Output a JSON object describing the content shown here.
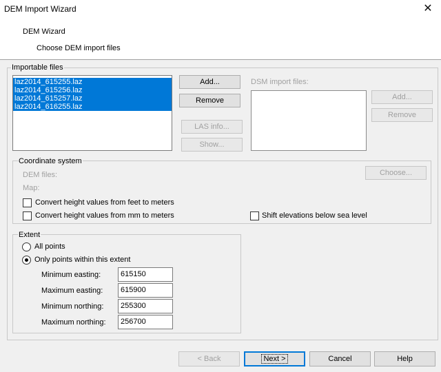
{
  "window": {
    "title": "DEM Import Wizard",
    "close_glyph": "✕"
  },
  "header": {
    "title": "DEM Wizard",
    "subtitle": "Choose DEM import files"
  },
  "importable": {
    "legend": "Importable files",
    "files": [
      "laz2014_615255.laz",
      "laz2014_615256.laz",
      "laz2014_615257.laz",
      "laz2014_616255.laz"
    ],
    "add_label": "Add...",
    "remove_label": "Remove",
    "las_info_label": "LAS info...",
    "show_label": "Show...",
    "dsm_label": "DSM import files:",
    "dsm_add_label": "Add...",
    "dsm_remove_label": "Remove"
  },
  "coordinate": {
    "legend": "Coordinate system",
    "dem_files_label": "DEM files:",
    "map_label": "Map:",
    "choose_label": "Choose...",
    "feet_to_meters_label": "Convert height values from feet to meters",
    "mm_to_meters_label": "Convert height values from mm to meters",
    "shift_label": "Shift elevations below sea level"
  },
  "extent": {
    "legend": "Extent",
    "all_points_label": "All points",
    "within_label": "Only points within this extent",
    "min_easting_label": "Minimum easting:",
    "max_easting_label": "Maximum easting:",
    "min_northing_label": "Minimum northing:",
    "max_northing_label": "Maximum northing:",
    "min_easting": "615150",
    "max_easting": "615900",
    "min_northing": "255300",
    "max_northing": "256700"
  },
  "footer": {
    "back_label": "< Back",
    "next_label": "Next >",
    "cancel_label": "Cancel",
    "help_label": "Help"
  },
  "colors": {
    "selection": "#0078d7",
    "dialog_bg": "#f0f0f0"
  }
}
